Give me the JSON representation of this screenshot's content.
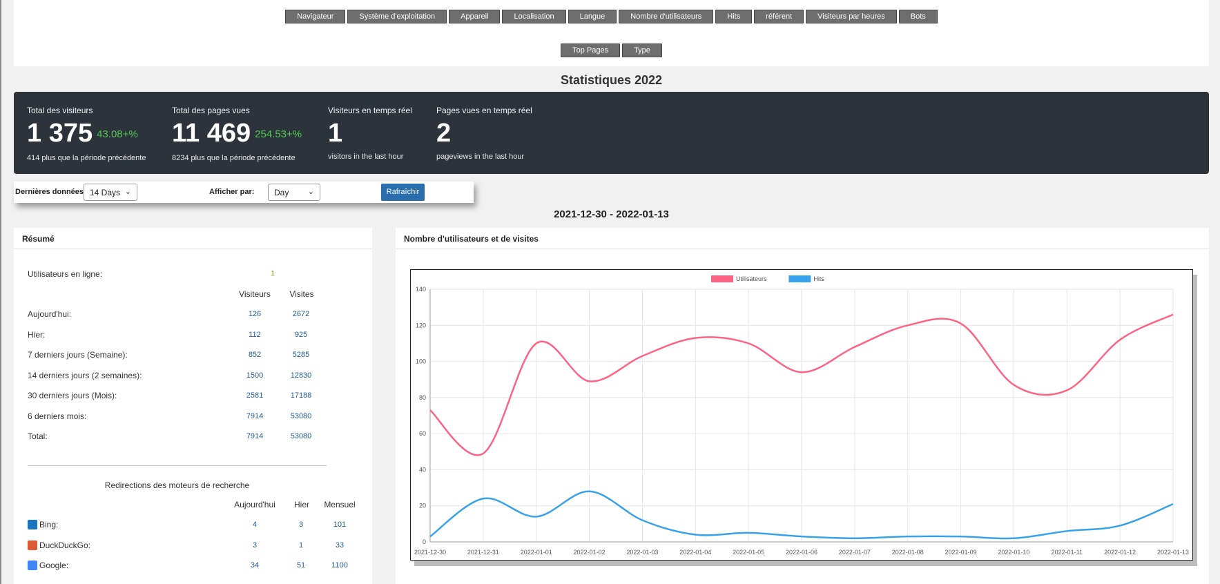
{
  "nav_tabs_row1": [
    "Navigateur",
    "Système d'exploitation",
    "Appareil",
    "Localisation",
    "Langue",
    "Nombre d'utilisateurs",
    "Hits",
    "référent",
    "Visiteurs par heures",
    "Bots"
  ],
  "nav_tabs_row2": [
    "Top Pages",
    "Type"
  ],
  "page_title": "Statistiques 2022",
  "stats": {
    "total_visitors": {
      "label": "Total des visiteurs",
      "value": "1 375",
      "change": "43.08+%",
      "sub": "414 plus que la période précédente"
    },
    "total_pageviews": {
      "label": "Total des pages vues",
      "value": "11 469",
      "change": "254.53+%",
      "sub": "8234 plus que la période précédente"
    },
    "realtime_visitors": {
      "label": "Visiteurs en temps réel",
      "value": "1",
      "sub": "visitors in the last hour"
    },
    "realtime_pageviews": {
      "label": "Pages vues en temps réel",
      "value": "2",
      "sub": "pageviews in the last hour"
    }
  },
  "filters": {
    "last_data_label": "Dernières données:",
    "last_data_value": "14 Days",
    "display_by_label": "Afficher par:",
    "display_by_value": "Day",
    "refresh_label": "Rafraîchir"
  },
  "date_range": "2021-12-30 - 2022-01-13",
  "summary": {
    "title": "Résumé",
    "online_label": "Utilisateurs en ligne:",
    "online_value": "1",
    "col_visitors": "Visiteurs",
    "col_visits": "Visites",
    "rows": [
      {
        "label": "Aujourd'hui:",
        "visitors": "126",
        "visits": "2672"
      },
      {
        "label": "Hier:",
        "visitors": "112",
        "visits": "925"
      },
      {
        "label": "7 derniers jours (Semaine):",
        "visitors": "852",
        "visits": "5285"
      },
      {
        "label": "14 derniers jours (2 semaines):",
        "visitors": "1500",
        "visits": "12830"
      },
      {
        "label": "30 derniers jours (Mois):",
        "visitors": "2581",
        "visits": "17188"
      },
      {
        "label": "6 derniers mois:",
        "visitors": "7914",
        "visits": "53080"
      },
      {
        "label": "Total:",
        "visitors": "7914",
        "visits": "53080"
      }
    ],
    "search_title": "Redirections des moteurs de recherche",
    "search_cols": [
      "Aujourd'hui",
      "Hier",
      "Mensuel"
    ],
    "engines": [
      {
        "name": "Bing:",
        "today": "4",
        "yesterday": "3",
        "monthly": "101",
        "icon": "bing-icon",
        "color": "#1e73be"
      },
      {
        "name": "DuckDuckGo:",
        "today": "3",
        "yesterday": "1",
        "monthly": "33",
        "icon": "duckduckgo-icon",
        "color": "#de5833"
      },
      {
        "name": "Google:",
        "today": "34",
        "yesterday": "51",
        "monthly": "1100",
        "icon": "google-icon",
        "color": "#4285f4"
      }
    ]
  },
  "chart_panel_title": "Nombre d'utilisateurs et de visites",
  "chart_data": {
    "type": "line",
    "x": [
      "2021-12-30",
      "2021-12-31",
      "2022-01-01",
      "2022-01-02",
      "2022-01-03",
      "2022-01-04",
      "2022-01-05",
      "2022-01-06",
      "2022-01-07",
      "2022-01-08",
      "2022-01-09",
      "2022-01-10",
      "2022-01-11",
      "2022-01-12",
      "2022-01-13"
    ],
    "series": [
      {
        "name": "Utilisateurs",
        "color": "#ff6384",
        "values": [
          73,
          49,
          110,
          89,
          103,
          113,
          110,
          94,
          108,
          120,
          121,
          87,
          84,
          112,
          126
        ]
      },
      {
        "name": "Hits",
        "color": "#36a2eb",
        "values": [
          3,
          24,
          14,
          28,
          12,
          4,
          5,
          3,
          2,
          3,
          3,
          2,
          6,
          9,
          21
        ]
      }
    ],
    "ylim": [
      0,
      140
    ],
    "yticks": [
      0,
      20,
      40,
      60,
      80,
      100,
      120,
      140
    ],
    "grid": true,
    "legend": "top"
  }
}
